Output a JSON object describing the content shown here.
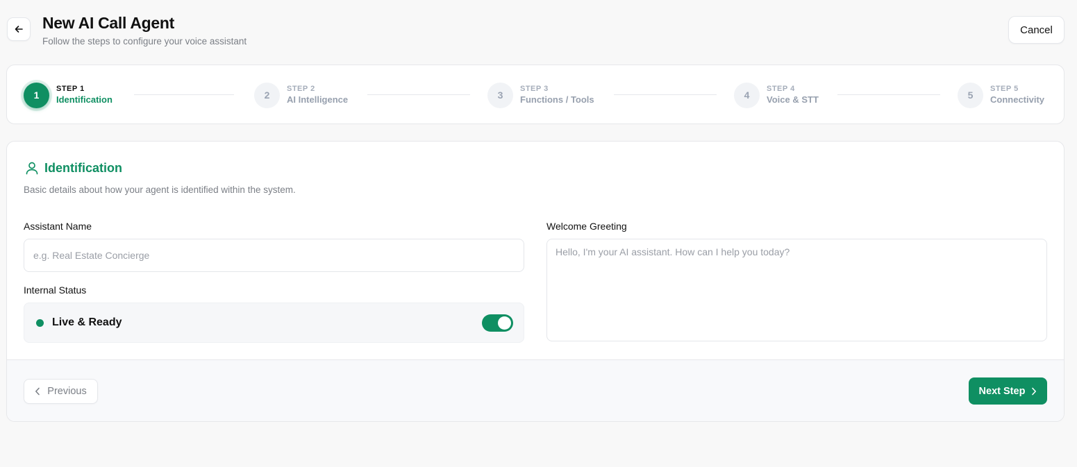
{
  "header": {
    "title": "New AI Call Agent",
    "subtitle": "Follow the steps to configure your voice assistant",
    "cancel_label": "Cancel"
  },
  "stepper": {
    "steps": [
      {
        "number": "1",
        "step_label": "STEP 1",
        "name": "Identification",
        "state": "active"
      },
      {
        "number": "2",
        "step_label": "STEP 2",
        "name": "AI Intelligence",
        "state": "inactive"
      },
      {
        "number": "3",
        "step_label": "STEP 3",
        "name": "Functions / Tools",
        "state": "inactive"
      },
      {
        "number": "4",
        "step_label": "STEP 4",
        "name": "Voice & STT",
        "state": "inactive"
      },
      {
        "number": "5",
        "step_label": "STEP 5",
        "name": "Connectivity",
        "state": "inactive"
      }
    ]
  },
  "section": {
    "icon": "user-icon",
    "title": "Identification",
    "description": "Basic details about how your agent is identified within the system."
  },
  "form": {
    "assistant_name": {
      "label": "Assistant Name",
      "value": "",
      "placeholder": "e.g. Real Estate Concierge"
    },
    "internal_status": {
      "label": "Internal Status",
      "status_text": "Live & Ready",
      "enabled": true
    },
    "welcome_greeting": {
      "label": "Welcome Greeting",
      "value": "",
      "placeholder": "Hello, I'm your AI assistant. How can I help you today?"
    }
  },
  "footer": {
    "previous_label": "Previous",
    "next_label": "Next Step"
  },
  "colors": {
    "accent": "#0f8f62",
    "background": "#f8f8f8",
    "inactive_step": "#97a0ae"
  }
}
